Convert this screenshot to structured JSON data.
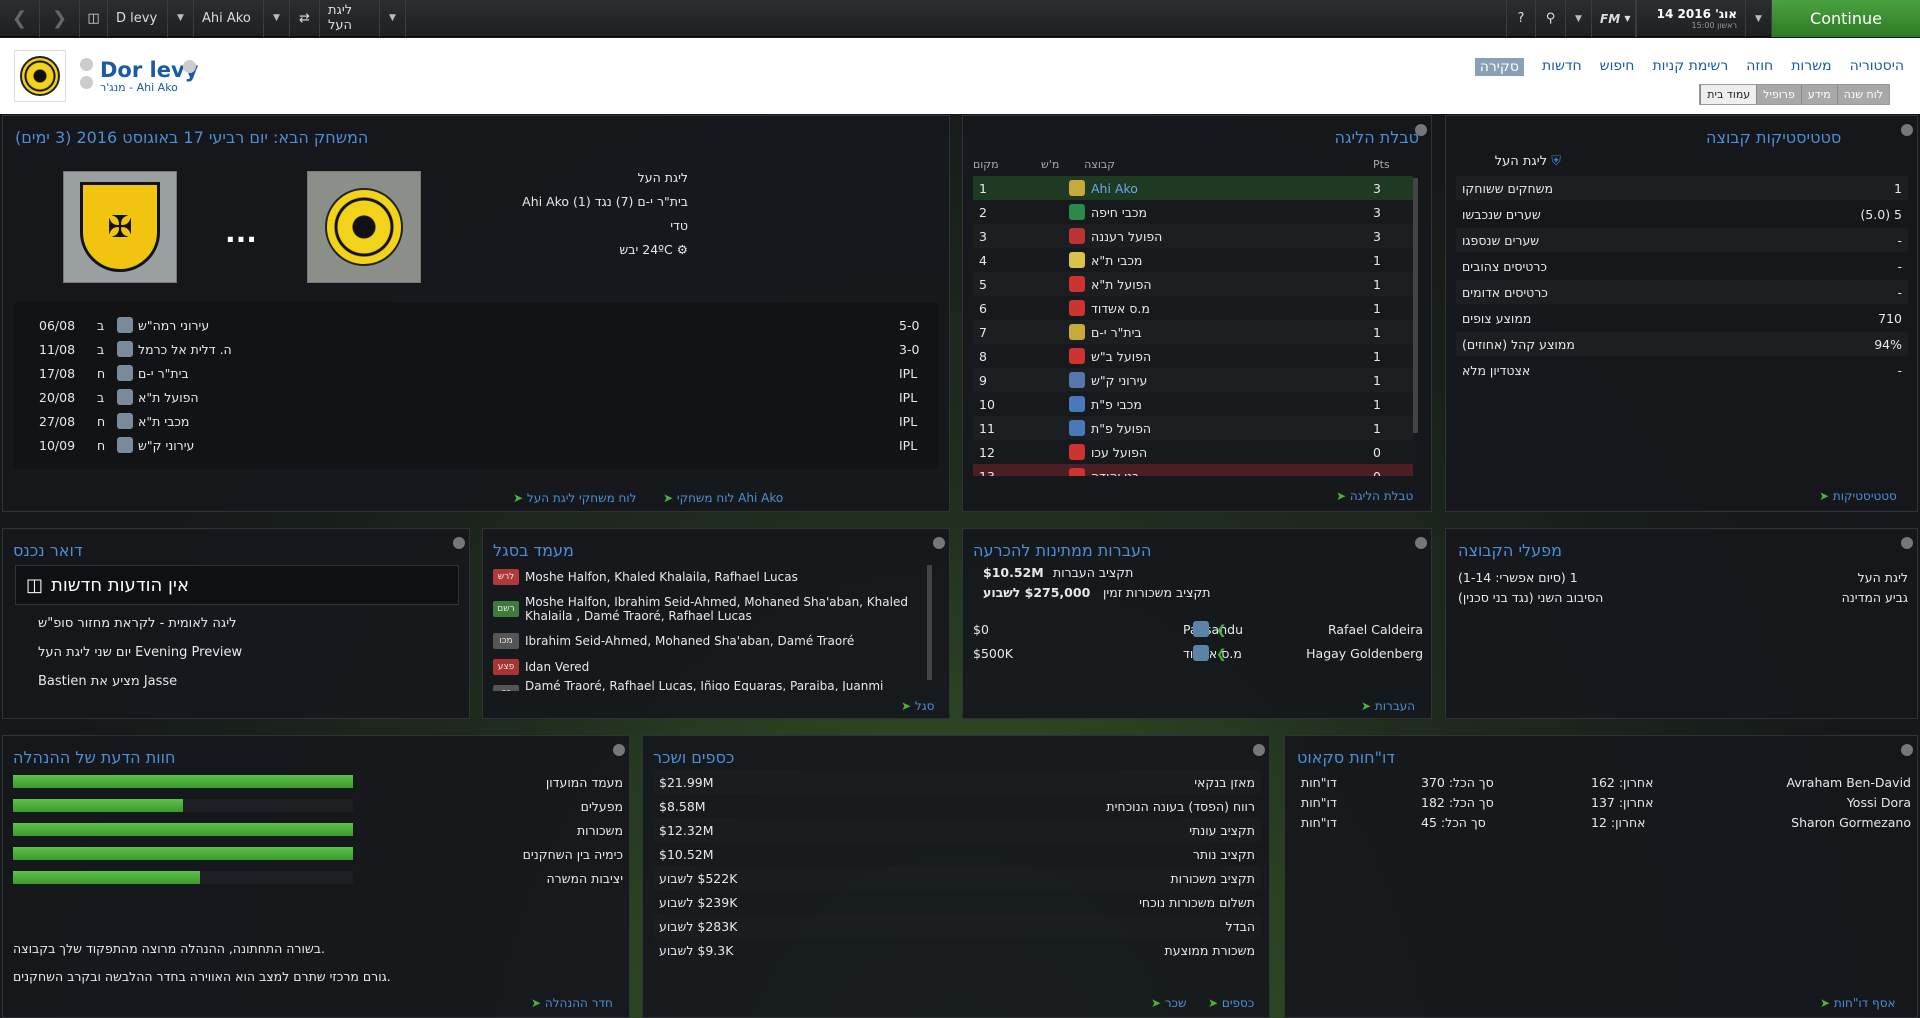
{
  "topbar": {
    "manager": "D levy",
    "club": "Ahi Ako",
    "league": "ליגת העל",
    "date": "14 אוג' 2016",
    "time": "15:00 ראשון",
    "fm": "FM",
    "continue": "Continue"
  },
  "header": {
    "name": "Dor levy",
    "subtitle": "מנג'ר - Ahi Ako",
    "nav": [
      "היסטוריה",
      "משרות",
      "חוזה",
      "רשימת קניות",
      "חיפוש",
      "חדשות",
      "סקירה"
    ],
    "subnav": [
      "עמוד בית",
      "פרופיל",
      "מידע",
      "לוח שנה"
    ]
  },
  "next_match": {
    "title": "המשחק הבא: יום רביעי 17 באוגוסט 2016 (3 ימים)",
    "competition": "ליגת העל",
    "fixture": "בית\"ר י-ם (7) נגד Ahi Ako (1)",
    "tv": "טדי",
    "weather": "24ºC יבש",
    "vs": "...",
    "fixtures": [
      {
        "date": "06/08",
        "ha": "ב",
        "team": "עירוני רמה\"ש",
        "result": "5-0"
      },
      {
        "date": "11/08",
        "ha": "ב",
        "team": "ה. דלית אל כרמל",
        "result": "3-0"
      },
      {
        "date": "17/08",
        "ha": "ח",
        "team": "בית\"ר י-ם",
        "result": "IPL"
      },
      {
        "date": "20/08",
        "ha": "ב",
        "team": "הפועל ת\"א",
        "result": "IPL"
      },
      {
        "date": "27/08",
        "ha": "ח",
        "team": "מכבי ת\"א",
        "result": "IPL"
      },
      {
        "date": "10/09",
        "ha": "ח",
        "team": "עירוני ק\"ש",
        "result": "IPL"
      }
    ],
    "link1": "לוח משחקי Ahi Ako",
    "link2": "לוח משחקי ליגת העל"
  },
  "league_table": {
    "title": "טבלת הליגה",
    "headers": {
      "pos": "מקום",
      "pl": "מ'ש",
      "team": "קבוצה",
      "pts": "Pts"
    },
    "rows": [
      {
        "pos": "1",
        "team": "Ahi Ako",
        "pts": "3"
      },
      {
        "pos": "2",
        "team": "מכבי חיפה",
        "pts": "3"
      },
      {
        "pos": "3",
        "team": "הפועל רעננה",
        "pts": "3"
      },
      {
        "pos": "4",
        "team": "מכבי ת\"א",
        "pts": "1"
      },
      {
        "pos": "5",
        "team": "הפועל ת\"א",
        "pts": "1"
      },
      {
        "pos": "6",
        "team": "מ.ס אשדוד",
        "pts": "1"
      },
      {
        "pos": "7",
        "team": "בית\"ר י-ם",
        "pts": "1"
      },
      {
        "pos": "8",
        "team": "הפועל ב\"ש",
        "pts": "1"
      },
      {
        "pos": "9",
        "team": "עירוני ק\"ש",
        "pts": "1"
      },
      {
        "pos": "10",
        "team": "מכבי פ\"ת",
        "pts": "1"
      },
      {
        "pos": "11",
        "team": "הפועל פ\"ת",
        "pts": "1"
      },
      {
        "pos": "12",
        "team": "הפועל עכו",
        "pts": "0"
      },
      {
        "pos": "13",
        "team": "בני יהודה",
        "pts": "0"
      }
    ],
    "link": "טבלת הליגה"
  },
  "team_stats": {
    "title": "סטטיסטיקות קבוצה",
    "league": "ליגת העל",
    "rows": [
      {
        "label": "משחקים ששוחקו",
        "value": "1"
      },
      {
        "label": "שערים שנכבשו",
        "value": "5 (5.0)"
      },
      {
        "label": "שערים שנספגו",
        "value": "-"
      },
      {
        "label": "כרטיסים צהובים",
        "value": "-"
      },
      {
        "label": "כרטיסים אדומים",
        "value": "-"
      },
      {
        "label": "ממוצע צופים",
        "value": "710"
      },
      {
        "label": "ממוצע קהל (אחוזים)",
        "value": "94%"
      },
      {
        "label": "אצטדיון מלא",
        "value": "-"
      }
    ],
    "link": "סטטיסטיקות"
  },
  "inbox": {
    "title": "דואר נכנס",
    "empty": "אין הודעות חדשות",
    "items": [
      "ליגה לאומית - לקראת מחזור סופ\"ש",
      "Evening Preview יום שני ליגת העל",
      "Jasse מציע את Bastien"
    ]
  },
  "squad_status": {
    "title": "מעמד בסגל",
    "rows": [
      {
        "tag": "לרש",
        "color": "#b03a3a",
        "text": "Moshe Halfon, Khaled Khalaila, Rafhael Lucas"
      },
      {
        "tag": "רשם",
        "color": "#3d7a3b",
        "text": "Moshe Halfon, Ibrahim Seid-Ahmed, Mohaned Sha'aban, Khaled Khalaila , Damé Traoré, Rafhael Lucas"
      },
      {
        "tag": "מכו",
        "color": "#555",
        "text": "Ibrahim Seid-Ahmed, Mohaned Sha'aban, Damé Traoré"
      },
      {
        "tag": "פצע",
        "color": "#a33",
        "text": "Idan Vered"
      },
      {
        "tag": "זר",
        "color": "#555",
        "text": "Damé Traoré, Rafhael Lucas, Iñigo Equaras, Paraiba, Juanmi Callejón"
      }
    ],
    "link": "סגל"
  },
  "transfers": {
    "title": "העברות ממתינות להכרעה",
    "budget_label": "תקציב העברות",
    "budget": "$10.52M",
    "wage_label": "תקציב משכורות זמין",
    "wage": "$275,000 לשבוע",
    "rows": [
      {
        "player": "Rafael Caldeira",
        "club": "Paysandu",
        "fee": "$0"
      },
      {
        "player": "Hagay Goldenberg",
        "club": "מ.ס אשדוד",
        "fee": "$500K"
      }
    ],
    "link": "העברות"
  },
  "club_comps": {
    "title": "מפעלי הקבוצה",
    "rows": [
      {
        "name": "ליגת העל",
        "status": "1 (סיום אפשרי: 1-14)"
      },
      {
        "name": "גביע המדינה",
        "status": "הסיבוב השני (נגד בני סכנין)"
      }
    ]
  },
  "board": {
    "title": "חוות הדעת של ההנהלה",
    "rows": [
      {
        "label": "מעמד המועדון",
        "pct": 1.0
      },
      {
        "label": "מפעלים",
        "pct": 0.5
      },
      {
        "label": "משכורות",
        "pct": 1.0
      },
      {
        "label": "כימיה בין השחקנים",
        "pct": 1.0
      },
      {
        "label": "יציבות המשרה",
        "pct": 0.55
      }
    ],
    "note1": "בשורה התחתונה, ההנהלה מרוצה מהתפקוד שלך בקבוצה.",
    "note2": "גורם מרכזי שתרם למצב הוא האווירה בחדר ההלבשה ובקרב השחקנים.",
    "link": "חדר ההנהלה"
  },
  "finances": {
    "title": "כספים ושכר",
    "rows": [
      {
        "label": "מאזן בנקאי",
        "value": "$21.99M"
      },
      {
        "label": "רווח (הפסד) בעונה הנוכחית",
        "value": "$8.58M"
      },
      {
        "label": "תקציב עונתי",
        "value": "$12.32M"
      },
      {
        "label": "תקציב נותר",
        "value": "$10.52M"
      },
      {
        "label": "תקציב משכורות",
        "value": "$522K לשבוע"
      },
      {
        "label": "תשלום משכורות נוכחי",
        "value": "$239K לשבוע"
      },
      {
        "label": "הבדל",
        "value": "$283K לשבוע"
      },
      {
        "label": "משכורת ממוצעת",
        "value": "$9.3K לשבוע"
      }
    ],
    "link1": "כספים",
    "link2": "שכר"
  },
  "scouts": {
    "title": "דו\"חות סקאוט",
    "rows": [
      {
        "name": "Avraham Ben-David",
        "last": "אחרון: 162",
        "total": "סך הכל: 370",
        "lbl": "דו\"חות"
      },
      {
        "name": "Yossi Dora",
        "last": "אחרון: 137",
        "total": "סך הכל: 182",
        "lbl": "דו\"חות"
      },
      {
        "name": "Sharon Gormezano",
        "last": "אחרון: 12",
        "total": "סך הכל: 45",
        "lbl": "דו\"חות"
      }
    ],
    "link": "אסף דו\"חות"
  }
}
